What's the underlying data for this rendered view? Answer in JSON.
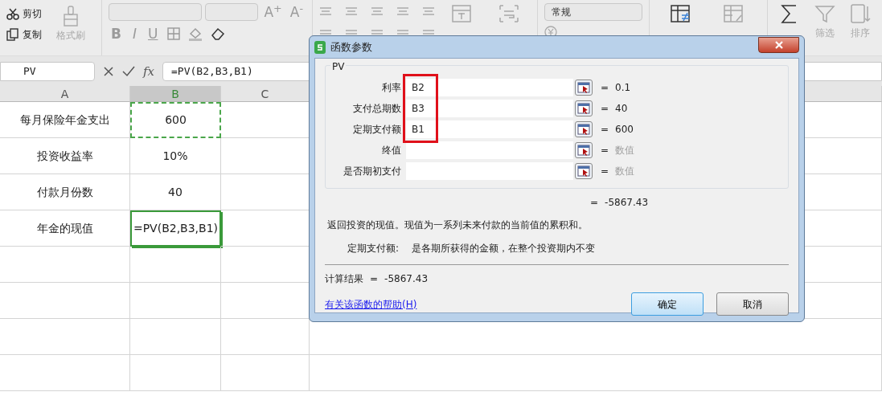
{
  "ribbon": {
    "clipboard": [
      {
        "kind": "cut",
        "label": "剪切"
      },
      {
        "kind": "copy",
        "label": "复制"
      }
    ],
    "format_painter": {
      "label": "格式刷",
      "disabled": true
    },
    "font_size_buttons": [
      "A$^{+}$",
      "A$^{-}$"
    ],
    "font_style_buttons": [
      "B",
      "I",
      "U"
    ],
    "number_format": "常规",
    "big_buttons": [
      {
        "kind": "merge",
        "disabled": true
      },
      {
        "kind": "wrap",
        "disabled": true
      },
      {
        "kind": "conditional",
        "disabled": false
      },
      {
        "kind": "table-style",
        "disabled": true
      },
      {
        "kind": "sum",
        "disabled": false
      },
      {
        "kind": "filter",
        "label": "筛选",
        "disabled": true
      },
      {
        "kind": "sort",
        "label": "排序",
        "disabled": true
      }
    ]
  },
  "formula_bar": {
    "name_box": "PV",
    "fx": "fx",
    "formula": "=PV(B2,B3,B1)"
  },
  "sheet": {
    "columns": [
      {
        "label": "A",
        "selected": false
      },
      {
        "label": "B",
        "selected": true
      },
      {
        "label": "C",
        "selected": false
      }
    ],
    "rows": [
      {
        "label": "每月保险年金支出",
        "value": "600",
        "copied": true,
        "active": false
      },
      {
        "label": "投资收益率",
        "value": "10%",
        "copied": false,
        "active": false
      },
      {
        "label": "付款月份数",
        "value": "40",
        "copied": false,
        "active": false
      },
      {
        "label": "年金的现值",
        "value": "=PV(B2,B3,B1)",
        "copied": false,
        "active": true
      }
    ]
  },
  "dialog": {
    "title": "函数参数",
    "function_name": "PV",
    "args": [
      {
        "label": "利率",
        "value": "B2",
        "equals": "=",
        "result": "0.1",
        "hint": false,
        "highlighted": true
      },
      {
        "label": "支付总期数",
        "value": "B3",
        "equals": "=",
        "result": "40",
        "hint": false,
        "highlighted": true
      },
      {
        "label": "定期支付额",
        "value": "B1",
        "equals": "=",
        "result": "600",
        "hint": false,
        "highlighted": true
      },
      {
        "label": "终值",
        "equals": "=",
        "result": "数值",
        "hint": true,
        "highlighted": false
      },
      {
        "label": "是否期初支付",
        "equals": "=",
        "result": "数值",
        "hint": true,
        "highlighted": false
      }
    ],
    "formula_equals": "=",
    "formula_result": "-5867.43",
    "description": "返回投资的现值。现值为一系列未来付款的当前值的累积和。",
    "arg_help_label": "定期支付额:",
    "arg_help_text": "是各期所获得的金额，在整个投资期内不变",
    "calc_label": "计算结果",
    "calc_equals": "=",
    "calc_value": "-5867.43",
    "help_link": "有关该函数的帮助(H)",
    "buttons": [
      {
        "label": "确定",
        "default": true
      },
      {
        "label": "取消",
        "default": false
      }
    ]
  }
}
